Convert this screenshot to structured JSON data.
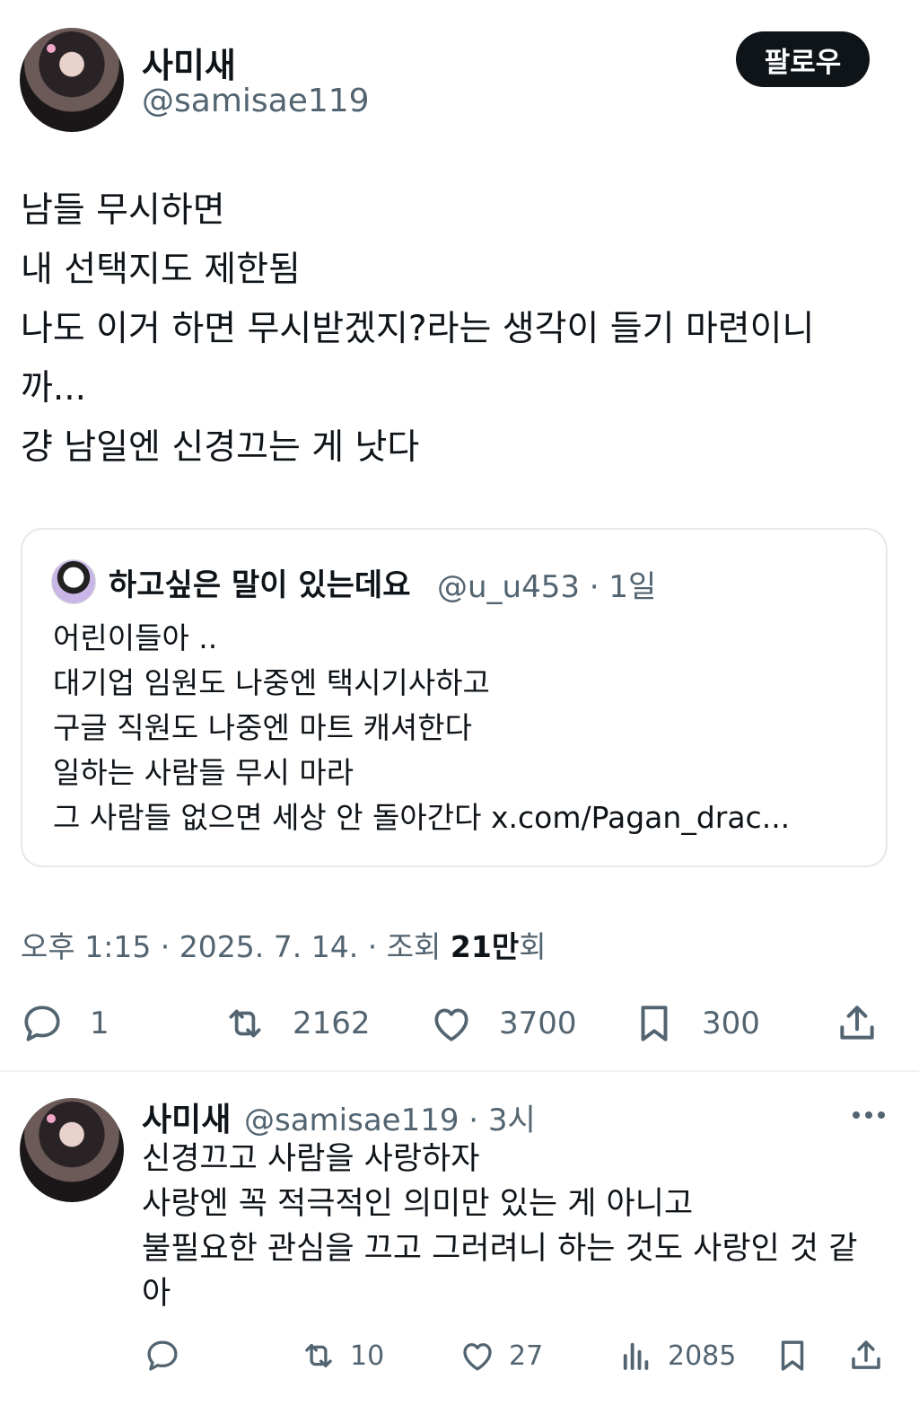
{
  "main_tweet": {
    "author_name": "사미새",
    "author_handle": "@samisae119",
    "follow_label": "팔로우",
    "lines": [
      "남들 무시하면",
      "내 선택지도 제한됨",
      "나도 이거 하면 무시받겠지?라는 생각이 들기 마련이니",
      "까...",
      "걍 남일엔 신경끄는 게 낫다"
    ],
    "quote": {
      "author_name": "하고싶은 말이 있는데요",
      "handle_time": "@u_u453 · 1일",
      "lines": [
        "어린이들아 ..",
        "대기업 임원도 나중엔 택시기사하고",
        "구글 직원도 나중엔 마트 캐셔한다",
        "일하는 사람들 무시 마라",
        "그 사람들 없으면 세상 안 돌아간다 x.com/Pagan_drac..."
      ]
    },
    "meta": {
      "time_date": "오후 1:15 · 2025. 7. 14. · 조회 ",
      "views_number": "21만",
      "views_suffix": "회"
    },
    "actions": {
      "replies": "1",
      "retweets": "2162",
      "likes": "3700",
      "bookmarks": "300"
    }
  },
  "reply_tweet": {
    "author_name": "사미새",
    "handle_time": "@samisae119 · 3시",
    "lines": [
      "신경끄고 사람을 사랑하자",
      "사랑엔 꼭 적극적인 의미만 있는 게 아니고",
      "불필요한 관심을 끄고 그러려니 하는 것도 사랑인 것 같",
      "아"
    ],
    "actions": {
      "retweets": "10",
      "likes": "27",
      "views": "2085"
    }
  },
  "icons": {
    "reply": "reply-icon",
    "retweet": "retweet-icon",
    "like": "heart-icon",
    "bookmark": "bookmark-icon",
    "share": "share-icon",
    "views": "views-icon",
    "more": "more-icon"
  },
  "colors": {
    "text": "#0f1419",
    "secondary": "#536471",
    "follow_button": "#0f1419"
  }
}
